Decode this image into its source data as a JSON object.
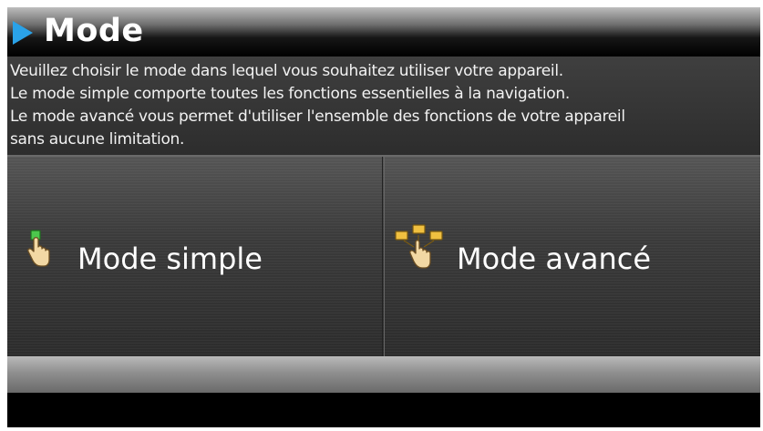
{
  "header": {
    "title": "Mode"
  },
  "description": {
    "lines": [
      "Veuillez choisir le mode dans lequel vous souhaitez utiliser votre appareil.",
      "Le mode simple comporte toutes les fonctions essentielles à la navigation.",
      "Le mode avancé vous permet d'utiliser l'ensemble des fonctions de votre appareil",
      "sans aucune limitation."
    ]
  },
  "modes": {
    "simple": {
      "label": "Mode simple",
      "icon": "hand-pointer-icon"
    },
    "advanced": {
      "label": "Mode avancé",
      "icon": "hand-multi-pointer-icon"
    }
  },
  "colors": {
    "accent": "#2aa2e8",
    "text": "#ffffff",
    "background": "#000000"
  }
}
